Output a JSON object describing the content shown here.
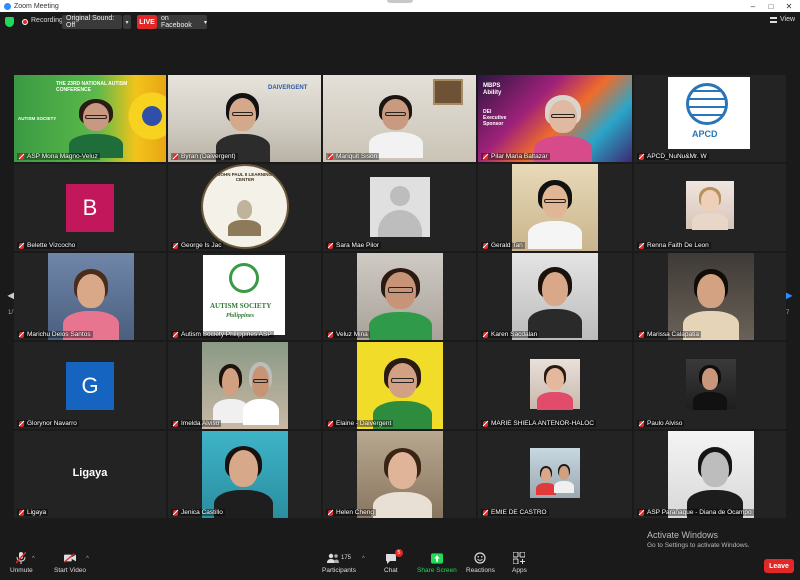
{
  "window": {
    "title": "Zoom Meeting"
  },
  "topbar": {
    "recording": "Recording",
    "original_sound": "Original Sound: Off",
    "live_badge": "LIVE",
    "live_target": "on Facebook",
    "view": "View"
  },
  "tiles": [
    {
      "name": "ASP Mona Magno-Veluz"
    },
    {
      "name": "Byran (Daivergent)"
    },
    {
      "name": "Mariquit Sison"
    },
    {
      "name": "Pilar Maria Baltazar"
    },
    {
      "name": "APCD_NuNu&Mr. W"
    },
    {
      "name": "Belette Vizcocho",
      "avatar_letter": "B"
    },
    {
      "name": "George   Is Jac"
    },
    {
      "name": "Sara Mae Pilor"
    },
    {
      "name": "Gerald Tan"
    },
    {
      "name": "Renna Faith De Leon"
    },
    {
      "name": "Marichu Delos Santos"
    },
    {
      "name": "Autism Society Philippines ASP"
    },
    {
      "name": "Veluz Mina"
    },
    {
      "name": "Karen Sacdalan"
    },
    {
      "name": "Marissa Calapatia"
    },
    {
      "name": "Glorynor Navarro",
      "avatar_letter": "G"
    },
    {
      "name": "Imelda Alviso"
    },
    {
      "name": "Elaine - Daivergent"
    },
    {
      "name": "MARIE SHIELA ANTENOR-HALOC"
    },
    {
      "name": "Paulo Alviso"
    },
    {
      "name": "Ligaya",
      "display_name": "Ligaya"
    },
    {
      "name": "Jenica Castillo"
    },
    {
      "name": "Helen Cheng"
    },
    {
      "name": "EMIE DE CASTRO"
    },
    {
      "name": "ASP Parañaque - Diana de Ocampo"
    }
  ],
  "overlays": {
    "autism_conf_title": "THE 23RD NATIONAL AUTISM CONFERENCE",
    "autism_society_logo": "AUTISM SOCIETY",
    "autism_society_sub": "Philippines",
    "daivergent_logo": "DAIVERGENT",
    "mbps_text": "MBPS Ability",
    "dei_text": "DEI Executive Sponsor",
    "apcd_text": "APCD",
    "jp2_text": "JOHN PAUL II LEARNING CENTER"
  },
  "paging": {
    "left": "1/7",
    "right": "1/7"
  },
  "toolbar": {
    "unmute": "Unmute",
    "start_video": "Start Video",
    "participants": "Participants",
    "participant_count": "175",
    "chat": "Chat",
    "chat_badge": "5",
    "share_screen": "Share Screen",
    "reactions": "Reactions",
    "apps": "Apps",
    "leave": "Leave"
  },
  "watermark": {
    "line1": "Activate Windows",
    "line2": "Go to Settings to activate Windows."
  },
  "colors": {
    "active_speaker": "#f5e35e",
    "live": "#e02828",
    "share": "#23d959",
    "background": "#1a1a1a"
  }
}
